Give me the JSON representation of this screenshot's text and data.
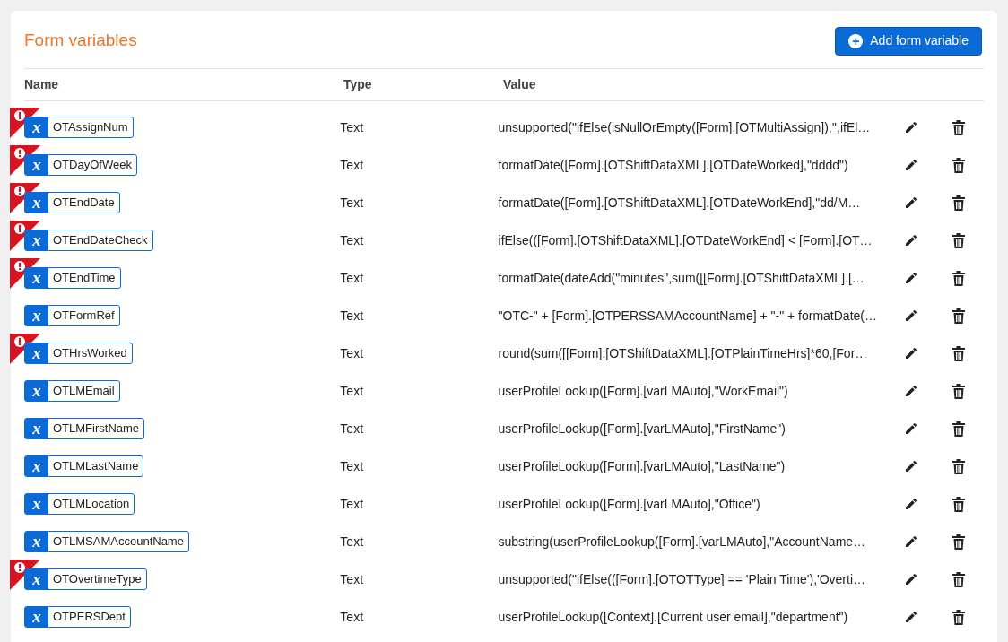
{
  "title": "Form variables",
  "add_button": {
    "icon": "+",
    "label": "Add form variable"
  },
  "table": {
    "columns": [
      "Name",
      "Type",
      "Value"
    ],
    "rows": [
      {
        "name": "OTAssignNum",
        "badge_glyph": "x",
        "warning": true,
        "type": "Text",
        "value": "unsupported(\"ifElse(isNullOrEmpty([Form].[OTMultiAssign]),'',ifEl…"
      },
      {
        "name": "OTDayOfWeek",
        "badge_glyph": "x",
        "warning": true,
        "type": "Text",
        "value": "formatDate([Form].[OTShiftDataXML].[OTDateWorked],\"dddd\")"
      },
      {
        "name": "OTEndDate",
        "badge_glyph": "x",
        "warning": true,
        "type": "Text",
        "value": "formatDate([Form].[OTShiftDataXML].[OTDateWorkEnd],\"dd/M…"
      },
      {
        "name": "OTEndDateCheck",
        "badge_glyph": "x",
        "warning": true,
        "type": "Text",
        "value": "ifElse(([Form].[OTShiftDataXML].[OTDateWorkEnd] < [Form].[OT…"
      },
      {
        "name": "OTEndTime",
        "badge_glyph": "x",
        "warning": true,
        "type": "Text",
        "value": "formatDate(dateAdd(\"minutes\",sum([[Form].[OTShiftDataXML].[…"
      },
      {
        "name": "OTFormRef",
        "badge_glyph": "x",
        "warning": false,
        "type": "Text",
        "value": "\"OTC-\" + [Form].[OTPERSSAMAccountName] + \"-\" + formatDate(…"
      },
      {
        "name": "OTHrsWorked",
        "badge_glyph": "x",
        "warning": true,
        "type": "Text",
        "value": "round(sum([[Form].[OTShiftDataXML].[OTPlainTimeHrs]*60,[For…"
      },
      {
        "name": "OTLMEmail",
        "badge_glyph": "x",
        "warning": false,
        "type": "Text",
        "value": "userProfileLookup([Form].[varLMAuto],\"WorkEmail\")"
      },
      {
        "name": "OTLMFirstName",
        "badge_glyph": "x",
        "warning": false,
        "type": "Text",
        "value": "userProfileLookup([Form].[varLMAuto],\"FirstName\")"
      },
      {
        "name": "OTLMLastName",
        "badge_glyph": "x",
        "warning": false,
        "type": "Text",
        "value": "userProfileLookup([Form].[varLMAuto],\"LastName\")"
      },
      {
        "name": "OTLMLocation",
        "badge_glyph": "x",
        "warning": false,
        "type": "Text",
        "value": "userProfileLookup([Form].[varLMAuto],\"Office\")"
      },
      {
        "name": "OTLMSAMAccountName",
        "badge_glyph": "x",
        "warning": false,
        "type": "Text",
        "value": "substring(userProfileLookup([Form].[varLMAuto],\"AccountName…"
      },
      {
        "name": "OTOvertimeType",
        "badge_glyph": "x",
        "warning": true,
        "type": "Text",
        "value": "unsupported(\"ifElse(([Form].[OTOTType] == 'Plain Time'),'Overti…"
      },
      {
        "name": "OTPERSDept",
        "badge_glyph": "x",
        "warning": false,
        "type": "Text",
        "value": "userProfileLookup([Context].[Current user email],\"department\")"
      }
    ]
  }
}
